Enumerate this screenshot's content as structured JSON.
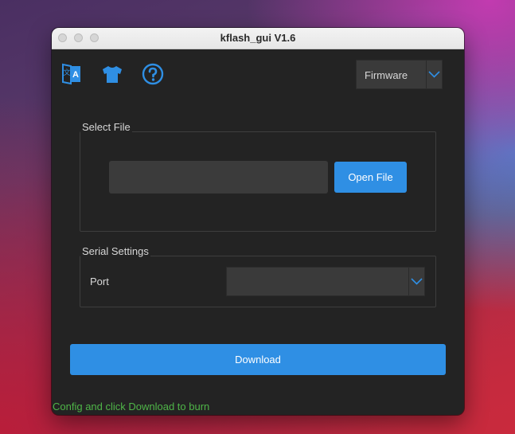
{
  "window": {
    "title": "kflash_gui V1.6"
  },
  "toolbar": {
    "icons": [
      "language-icon",
      "skin-icon",
      "help-icon"
    ],
    "mode_select": {
      "value": "Firmware"
    }
  },
  "select_file": {
    "group_title": "Select File",
    "path_value": "",
    "open_button_label": "Open File"
  },
  "serial_settings": {
    "group_title": "Serial Settings",
    "port_label": "Port",
    "port_value": ""
  },
  "actions": {
    "download_label": "Download"
  },
  "status": {
    "text": "Config and click Download to burn"
  },
  "colors": {
    "accent": "#2f8fe4",
    "window_bg": "#232323",
    "status_text": "#4fb548"
  }
}
